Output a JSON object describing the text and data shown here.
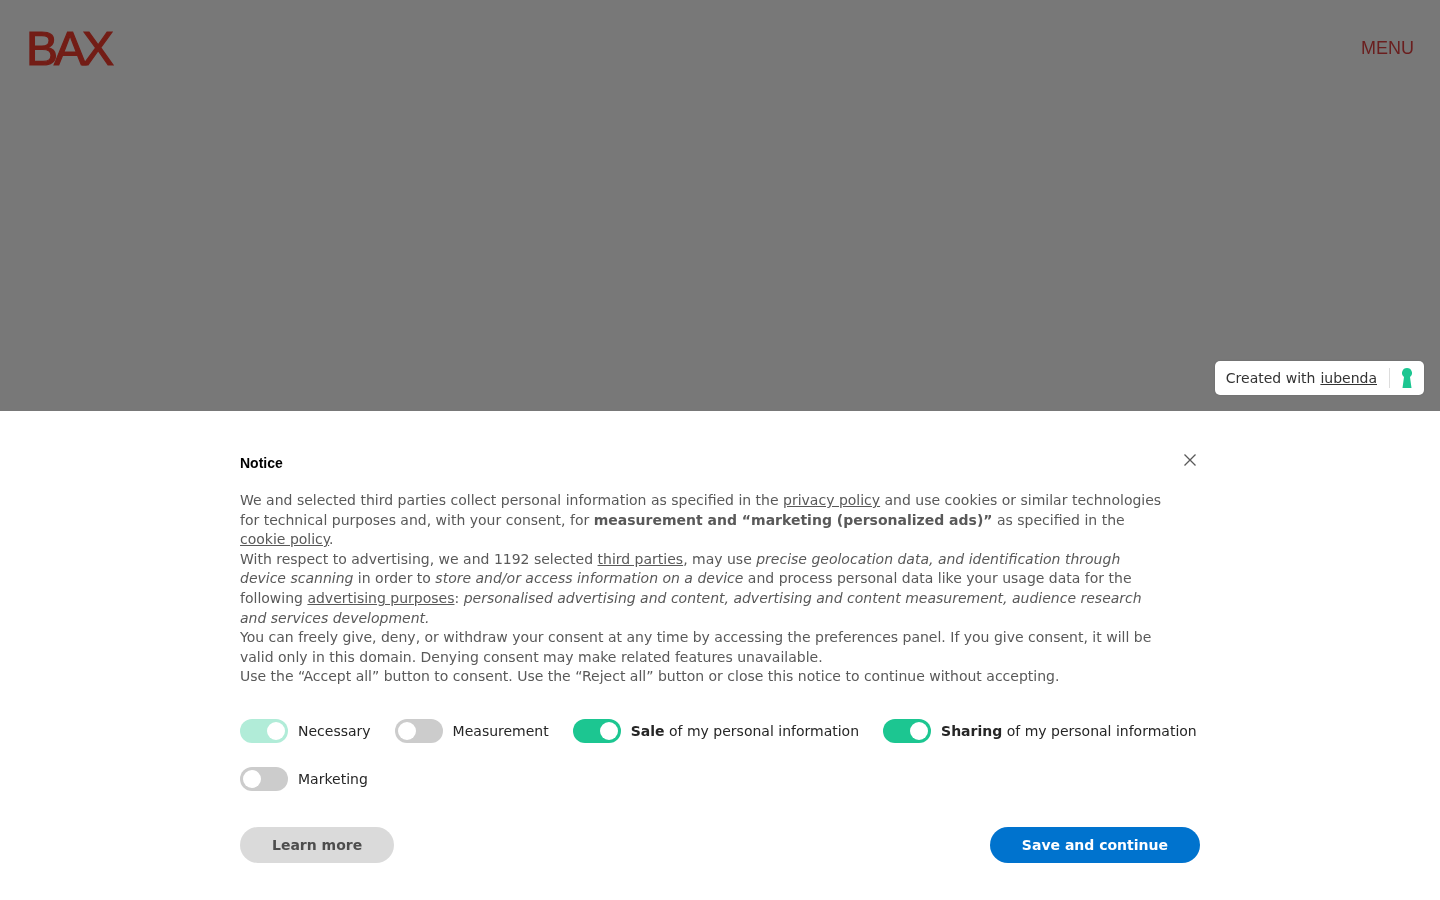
{
  "header": {
    "logo": "BAX",
    "menu": "MENU"
  },
  "credit_badge": {
    "text": "Created with",
    "link": "iubenda"
  },
  "notice": {
    "title": "Notice",
    "paragraphs": [
      {
        "parts": [
          {
            "kind": "text",
            "text": "We and selected third parties collect personal information as specified in the "
          },
          {
            "kind": "link",
            "text": "privacy policy"
          },
          {
            "kind": "text",
            "text": " and use cookies or similar technologies for technical purposes and, with your consent, for **measurement and “marketing (personalized ads)”** as specified in the "
          },
          {
            "kind": "link",
            "text": "cookie policy"
          },
          {
            "kind": "text",
            "text": "."
          }
        ]
      },
      {
        "parts": [
          {
            "kind": "text",
            "text": "With respect to advertising, we and 1192 selected "
          },
          {
            "kind": "link",
            "text": "third parties"
          },
          {
            "kind": "text",
            "text": ", may use *precise geolocation data, and identification through device scanning* in order to *store and/or access information on a device* and process personal data like your usage data for the following "
          },
          {
            "kind": "link",
            "text": "advertising purposes"
          },
          {
            "kind": "text",
            "text": ": *personalised advertising and content, advertising and content measurement, audience research and services development.*"
          }
        ]
      },
      {
        "parts": [
          {
            "kind": "text",
            "text": "You can freely give, deny, or withdraw your consent at any time by accessing the preferences panel. If you give consent, it will be valid only in this domain. Denying consent may make related features unavailable."
          }
        ]
      },
      {
        "parts": [
          {
            "kind": "text",
            "text": "Use the “Accept all” button to consent. Use the “Reject all” button or close this notice to continue without accepting."
          }
        ]
      }
    ],
    "toggles": [
      {
        "label": "Necessary",
        "checked": true,
        "disabled": true
      },
      {
        "label": "Measurement",
        "checked": false,
        "disabled": false
      },
      {
        "label": "**Sale** of my personal information",
        "checked": true,
        "disabled": false
      },
      {
        "label": "**Sharing** of my personal information",
        "checked": true,
        "disabled": false
      },
      {
        "label": "Marketing",
        "checked": false,
        "disabled": false
      }
    ],
    "buttons": [
      {
        "label": "Learn more",
        "kind": "secondary"
      },
      {
        "label": "Save and continue",
        "kind": "primary"
      }
    ]
  }
}
